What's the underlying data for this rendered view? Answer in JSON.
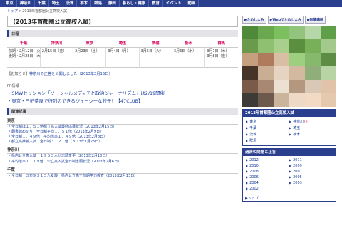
{
  "navbar": {
    "items": [
      "東京",
      "神奈川",
      "千葉",
      "埼玉",
      "茨城",
      "栃木",
      "群馬",
      "静岡",
      "暮らし・健康",
      "教育",
      "イベント",
      "動画"
    ]
  },
  "breadcrumb": {
    "home": "トップ",
    "sep": ">",
    "current": "2013年首都圏公立高校入試"
  },
  "page_title": "【2013年首都圏公立高校入試】",
  "schedule": {
    "section_label": "日程",
    "headers": [
      "千葉",
      "神奈川",
      "東京",
      "埼玉",
      "茨城",
      "栃木",
      "群馬"
    ],
    "rows": [
      [
        "前期・2月12日（火）\n後期・2月28日（木）",
        "2月15日（金）",
        "2月23日（土）",
        "3月4日（月）",
        "3月5日（火）",
        "3月6日（水）",
        "3月7日（木）\n3月8日（金）"
      ]
    ]
  },
  "notice": {
    "label": "【お知らせ】",
    "text": "神奈川の正答を公開しました（2013年2月15日）"
  },
  "pr": {
    "head": "PR情報",
    "links": [
      "SMWセッション「ソーシャルメディアと政治ジャーナリズム」は2/19開催",
      "東京・三軒茶屋で行列のできるジューシーな餃子！【47CLUB】"
    ]
  },
  "related": {
    "head": "関連記事",
    "groups": [
      {
        "title": "東京",
        "links": [
          "全日制は１．５１倍都立高入試最終応募状況（2013年2月15日）",
          "願書締め切り　全日制平均１．５１倍（2013年2月9日）",
          "全日制１．４９倍　平均倍率１．４９倍（2013年2月8日）",
          "都立高推薦入試　全日制３．２１倍（2013年1月25日）"
        ]
      },
      {
        "title": "神奈川",
        "links": [
          "県内公立高入試　１９５３人が志願変更（2013年2月10日）",
          "平均倍率１．１９倍　公立高入試全日制志願状況（2013年2月6日）"
        ]
      },
      {
        "title": "千葉",
        "links": [
          "全日制　３万９３１３人受験　県内公立高で前期学力検査（2013年2月13日）"
        ]
      }
    ]
  },
  "sidebar": {
    "share_buttons": [
      "▶ためしよみ",
      "▶Webでためしよみ",
      "▶新聞購読"
    ],
    "ad_colors": [
      "#4f8a3a",
      "#6aa84f",
      "#7bbf5e",
      "#93c47d",
      "#b6d7a8",
      "#5f9f4a",
      "#6a9a4c",
      "#8fbf70",
      "#a8cf8c",
      "#5a8f40",
      "#78b05a",
      "#a4c98c",
      "#c4a07e",
      "#b07b5c",
      "#d8bfa3",
      "#9ccf7f",
      "#86b96b",
      "#5d8c45",
      "#463428",
      "#c9ae93",
      "#e6d3c1",
      "#d3b9a0",
      "#8fae7a",
      "#b8d3a4",
      "#7a5a48",
      "#a88872",
      "#ece0d2",
      "#b4977f",
      "#d9c8b6",
      "#e0c3a8",
      "#3e3a38",
      "#6e5a4c",
      "#cbb49c",
      "#edd9c6",
      "#f2dac4",
      "#e5c9ad"
    ],
    "panel1": {
      "title": "2013年首都圏公立高校入試",
      "links": [
        {
          "label": "東京",
          "badge": ""
        },
        {
          "label": "神奈川",
          "badge": "(正)"
        },
        {
          "label": "千葉",
          "badge": ""
        },
        {
          "label": "埼玉",
          "badge": ""
        },
        {
          "label": "茨城",
          "badge": ""
        },
        {
          "label": "栃木",
          "badge": ""
        },
        {
          "label": "群馬",
          "badge": ""
        }
      ]
    },
    "panel2": {
      "title": "過去の問題と正答",
      "years": [
        "2012",
        "2011",
        "2010",
        "2009",
        "2008",
        "2007",
        "2006",
        "2005",
        "2004",
        "2003",
        "2002"
      ],
      "top_link": "トップ"
    }
  },
  "colors": {
    "nav_bg": "#2b3f8f",
    "link": "#1a3f9c",
    "accent_pink": "#d20059"
  }
}
